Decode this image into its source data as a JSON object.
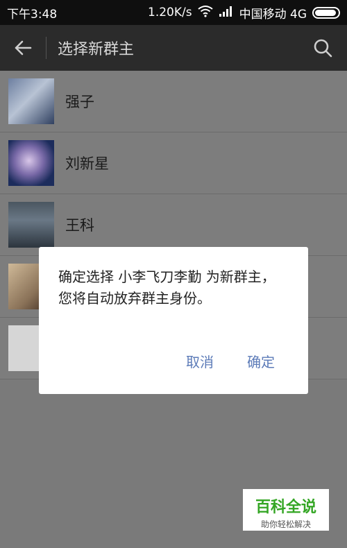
{
  "status_bar": {
    "time": "下午3:48",
    "speed": "1.20K/s",
    "carrier": "中国移动 4G"
  },
  "app_bar": {
    "title": "选择新群主"
  },
  "contacts": [
    {
      "name": "强子"
    },
    {
      "name": "刘新星"
    },
    {
      "name": "王科"
    },
    {
      "name": ""
    },
    {
      "name": ""
    }
  ],
  "dialog": {
    "message": "确定选择 小李飞刀李勤 为新群主，您将自动放弃群主身份。",
    "cancel_label": "取消",
    "ok_label": "确定"
  },
  "watermark": {
    "title": "百科全说",
    "subtitle": "助你轻松解决"
  },
  "colors": {
    "dialog_button": "#5c7bb8",
    "status_bar": "#0f0f0f",
    "app_bar": "#2b2b2b",
    "watermark_green": "#34a624"
  },
  "icons": {
    "back": "arrow-left-icon",
    "search": "search-icon",
    "wifi": "wifi-icon",
    "signal": "signal-icon",
    "battery": "battery-icon"
  }
}
